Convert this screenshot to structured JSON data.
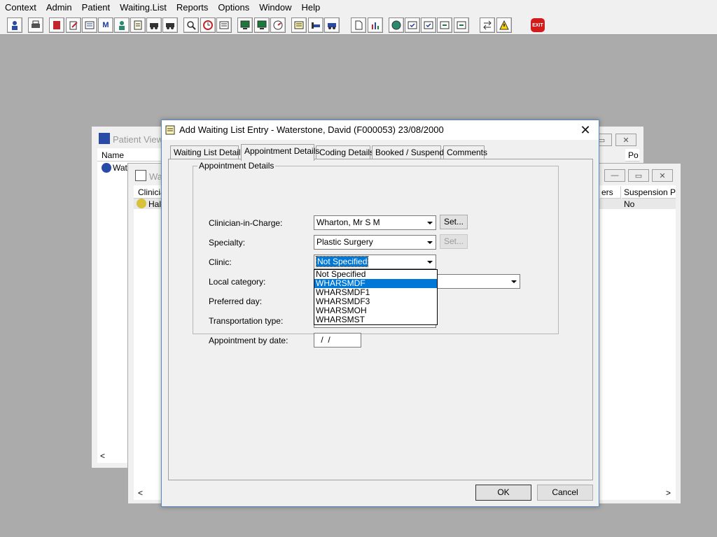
{
  "menu": [
    "Context",
    "Admin",
    "Patient",
    "Waiting.List",
    "Reports",
    "Options",
    "Window",
    "Help"
  ],
  "toolbar": {
    "exit_label": "EXIT",
    "icons": [
      "patient-icon",
      "print-icon",
      "book-icon",
      "edit-icon",
      "list-icon",
      "m-icon",
      "doctor-icon",
      "notes-icon",
      "van-icon",
      "van2-icon",
      "search-icon",
      "clock-icon",
      "card-icon",
      "screen-icon",
      "screen2-icon",
      "gauge-icon",
      "note-icon",
      "bed-icon",
      "ambulance-icon",
      "page-icon",
      "chart-icon",
      "globe-icon",
      "check-doc-icon",
      "check-doc2-icon",
      "arrow-doc-icon",
      "arrow-doc2-icon",
      "transfer-icon",
      "warning-icon"
    ]
  },
  "bg_windows": {
    "patient_view": {
      "title": "Patient View - ",
      "col_name": "Name",
      "col_po": "Po",
      "row1": "Wate"
    },
    "waiting_list": {
      "title": "Wa",
      "col_clinician": "Clinicia",
      "col_ers": "ers",
      "col_suspension": "Suspension Pe",
      "row1": "Hal",
      "row1_suspension": "No"
    }
  },
  "dialog": {
    "title": "Add Waiting List Entry - Waterstone, David (F000053) 23/08/2000",
    "tabs": [
      "Waiting List Details",
      "Appointment Details",
      "Coding Details",
      "Booked / Suspend",
      "Comments"
    ],
    "active_tab": "Appointment Details",
    "group_title": "Appointment Details",
    "fields": {
      "clinician_label": "Clinician-in-Charge:",
      "clinician_value": "Wharton, Mr S M",
      "specialty_label": "Specialty:",
      "specialty_value": "Plastic Surgery",
      "clinic_label": "Clinic:",
      "clinic_value": "Not Specified",
      "local_category_label": "Local category:",
      "preferred_day_label": "Preferred day:",
      "transport_label": "Transportation type:",
      "appt_by_date_label": "Appointment by date:",
      "appt_by_date_value": " /  /"
    },
    "set_label": "Set...",
    "clinic_options": [
      "Not Specified",
      "WHARSMDF",
      "WHARSMDF1",
      "WHARSMDF3",
      "WHARSMOH",
      "WHARSMST"
    ],
    "highlighted_option": "WHARSMDF",
    "ok_label": "OK",
    "cancel_label": "Cancel"
  }
}
